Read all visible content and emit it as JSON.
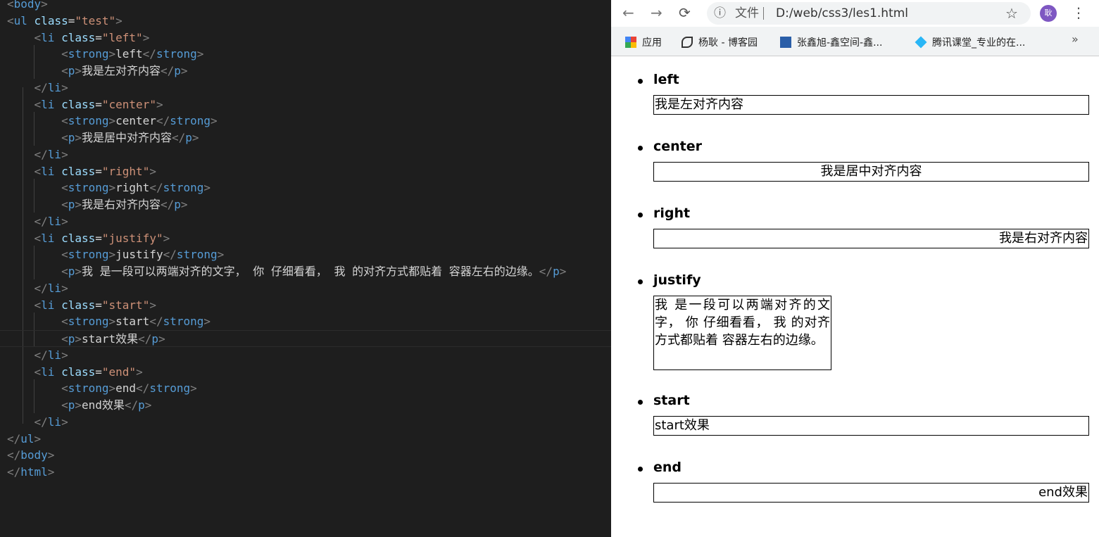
{
  "editor": {
    "lines": [
      [
        [
          "b",
          "<"
        ],
        [
          "t",
          "body"
        ],
        [
          "b",
          ">"
        ]
      ],
      [
        [
          "b",
          "<"
        ],
        [
          "t",
          "ul"
        ],
        [
          "x",
          " "
        ],
        [
          "a",
          "class"
        ],
        [
          "x",
          "="
        ],
        [
          "s",
          "\"test\""
        ],
        [
          "b",
          ">"
        ]
      ],
      [
        [
          "x",
          "    "
        ],
        [
          "b",
          "<"
        ],
        [
          "t",
          "li"
        ],
        [
          "x",
          " "
        ],
        [
          "a",
          "class"
        ],
        [
          "x",
          "="
        ],
        [
          "s",
          "\"left\""
        ],
        [
          "b",
          ">"
        ]
      ],
      [
        [
          "x",
          "        "
        ],
        [
          "b",
          "<"
        ],
        [
          "t",
          "strong"
        ],
        [
          "b",
          ">"
        ],
        [
          "x",
          "left"
        ],
        [
          "b",
          "</"
        ],
        [
          "t",
          "strong"
        ],
        [
          "b",
          ">"
        ]
      ],
      [
        [
          "x",
          "        "
        ],
        [
          "b",
          "<"
        ],
        [
          "t",
          "p"
        ],
        [
          "b",
          ">"
        ],
        [
          "x",
          "我是左对齐内容"
        ],
        [
          "b",
          "</"
        ],
        [
          "t",
          "p"
        ],
        [
          "b",
          ">"
        ]
      ],
      [
        [
          "x",
          "    "
        ],
        [
          "b",
          "</"
        ],
        [
          "t",
          "li"
        ],
        [
          "b",
          ">"
        ]
      ],
      [
        [
          "x",
          "    "
        ],
        [
          "b",
          "<"
        ],
        [
          "t",
          "li"
        ],
        [
          "x",
          " "
        ],
        [
          "a",
          "class"
        ],
        [
          "x",
          "="
        ],
        [
          "s",
          "\"center\""
        ],
        [
          "b",
          ">"
        ]
      ],
      [
        [
          "x",
          "        "
        ],
        [
          "b",
          "<"
        ],
        [
          "t",
          "strong"
        ],
        [
          "b",
          ">"
        ],
        [
          "x",
          "center"
        ],
        [
          "b",
          "</"
        ],
        [
          "t",
          "strong"
        ],
        [
          "b",
          ">"
        ]
      ],
      [
        [
          "x",
          "        "
        ],
        [
          "b",
          "<"
        ],
        [
          "t",
          "p"
        ],
        [
          "b",
          ">"
        ],
        [
          "x",
          "我是居中对齐内容"
        ],
        [
          "b",
          "</"
        ],
        [
          "t",
          "p"
        ],
        [
          "b",
          ">"
        ]
      ],
      [
        [
          "x",
          "    "
        ],
        [
          "b",
          "</"
        ],
        [
          "t",
          "li"
        ],
        [
          "b",
          ">"
        ]
      ],
      [
        [
          "x",
          "    "
        ],
        [
          "b",
          "<"
        ],
        [
          "t",
          "li"
        ],
        [
          "x",
          " "
        ],
        [
          "a",
          "class"
        ],
        [
          "x",
          "="
        ],
        [
          "s",
          "\"right\""
        ],
        [
          "b",
          ">"
        ]
      ],
      [
        [
          "x",
          "        "
        ],
        [
          "b",
          "<"
        ],
        [
          "t",
          "strong"
        ],
        [
          "b",
          ">"
        ],
        [
          "x",
          "right"
        ],
        [
          "b",
          "</"
        ],
        [
          "t",
          "strong"
        ],
        [
          "b",
          ">"
        ]
      ],
      [
        [
          "x",
          "        "
        ],
        [
          "b",
          "<"
        ],
        [
          "t",
          "p"
        ],
        [
          "b",
          ">"
        ],
        [
          "x",
          "我是右对齐内容"
        ],
        [
          "b",
          "</"
        ],
        [
          "t",
          "p"
        ],
        [
          "b",
          ">"
        ]
      ],
      [
        [
          "x",
          "    "
        ],
        [
          "b",
          "</"
        ],
        [
          "t",
          "li"
        ],
        [
          "b",
          ">"
        ]
      ],
      [
        [
          "x",
          "    "
        ],
        [
          "b",
          "<"
        ],
        [
          "t",
          "li"
        ],
        [
          "x",
          " "
        ],
        [
          "a",
          "class"
        ],
        [
          "x",
          "="
        ],
        [
          "s",
          "\"justify\""
        ],
        [
          "b",
          ">"
        ]
      ],
      [
        [
          "x",
          "        "
        ],
        [
          "b",
          "<"
        ],
        [
          "t",
          "strong"
        ],
        [
          "b",
          ">"
        ],
        [
          "x",
          "justify"
        ],
        [
          "b",
          "</"
        ],
        [
          "t",
          "strong"
        ],
        [
          "b",
          ">"
        ]
      ],
      [
        [
          "x",
          "        "
        ],
        [
          "b",
          "<"
        ],
        [
          "t",
          "p"
        ],
        [
          "b",
          ">"
        ],
        [
          "x",
          "我 是一段可以两端对齐的文字， 你 仔细看看， 我 的对齐方式都贴着 容器左右的边缘。"
        ],
        [
          "b",
          "</"
        ],
        [
          "t",
          "p"
        ],
        [
          "b",
          ">"
        ]
      ],
      [
        [
          "x",
          "    "
        ],
        [
          "b",
          "</"
        ],
        [
          "t",
          "li"
        ],
        [
          "b",
          ">"
        ]
      ],
      [
        [
          "x",
          "    "
        ],
        [
          "b",
          "<"
        ],
        [
          "t",
          "li"
        ],
        [
          "x",
          " "
        ],
        [
          "a",
          "class"
        ],
        [
          "x",
          "="
        ],
        [
          "s",
          "\"start\""
        ],
        [
          "b",
          ">"
        ]
      ],
      [
        [
          "x",
          "        "
        ],
        [
          "b",
          "<"
        ],
        [
          "t",
          "strong"
        ],
        [
          "b",
          ">"
        ],
        [
          "x",
          "start"
        ],
        [
          "b",
          "</"
        ],
        [
          "t",
          "strong"
        ],
        [
          "b",
          ">"
        ]
      ],
      [
        [
          "x",
          "        "
        ],
        [
          "b",
          "<"
        ],
        [
          "t",
          "p"
        ],
        [
          "b",
          ">"
        ],
        [
          "x",
          "start效果"
        ],
        [
          "b",
          "</"
        ],
        [
          "t",
          "p"
        ],
        [
          "b",
          ">"
        ]
      ],
      [
        [
          "x",
          "    "
        ],
        [
          "b",
          "</"
        ],
        [
          "t",
          "li"
        ],
        [
          "b",
          ">"
        ]
      ],
      [
        [
          "x",
          "    "
        ],
        [
          "b",
          "<"
        ],
        [
          "t",
          "li"
        ],
        [
          "x",
          " "
        ],
        [
          "a",
          "class"
        ],
        [
          "x",
          "="
        ],
        [
          "s",
          "\"end\""
        ],
        [
          "b",
          ">"
        ]
      ],
      [
        [
          "x",
          "        "
        ],
        [
          "b",
          "<"
        ],
        [
          "t",
          "strong"
        ],
        [
          "b",
          ">"
        ],
        [
          "x",
          "end"
        ],
        [
          "b",
          "</"
        ],
        [
          "t",
          "strong"
        ],
        [
          "b",
          ">"
        ]
      ],
      [
        [
          "x",
          "        "
        ],
        [
          "b",
          "<"
        ],
        [
          "t",
          "p"
        ],
        [
          "b",
          ">"
        ],
        [
          "x",
          "end效果"
        ],
        [
          "b",
          "</"
        ],
        [
          "t",
          "p"
        ],
        [
          "b",
          ">"
        ]
      ],
      [
        [
          "x",
          "    "
        ],
        [
          "b",
          "</"
        ],
        [
          "t",
          "li"
        ],
        [
          "b",
          ">"
        ]
      ],
      [
        [
          "b",
          "</"
        ],
        [
          "t",
          "ul"
        ],
        [
          "b",
          ">"
        ]
      ],
      [
        [
          "b",
          "</"
        ],
        [
          "t",
          "body"
        ],
        [
          "b",
          ">"
        ]
      ],
      [
        [
          "b",
          "</"
        ],
        [
          "t",
          "html"
        ],
        [
          "b",
          ">"
        ]
      ]
    ]
  },
  "browser": {
    "back_icon": "←",
    "forward_icon": "→",
    "reload_icon": "⟳",
    "info_icon": "ⓘ",
    "file_label": "文件",
    "url": "D:/web/css3/les1.html",
    "star_icon": "☆",
    "avatar": "耿",
    "menu_icon": "⋮",
    "bookmarks": [
      "应用",
      "杨耿 - 博客园",
      "张鑫旭-鑫空间-鑫...",
      "腾讯课堂_专业的在..."
    ],
    "more_bookmarks": "»"
  },
  "page": {
    "items": [
      {
        "title": "left",
        "text": "我是左对齐内容",
        "align": "left"
      },
      {
        "title": "center",
        "text": "我是居中对齐内容",
        "align": "center"
      },
      {
        "title": "right",
        "text": "我是右对齐内容",
        "align": "right"
      },
      {
        "title": "justify",
        "text": "我 是一段可以两端对齐的文字， 你 仔细看看， 我 的对齐方式都贴着 容器左右的边缘。",
        "align": "justify"
      },
      {
        "title": "start",
        "text": "start效果",
        "align": "left"
      },
      {
        "title": "end",
        "text": "end效果",
        "align": "right"
      }
    ]
  },
  "colors": {
    "editor_bg": "#1e1e1e",
    "avatar": "#7e57c2"
  }
}
